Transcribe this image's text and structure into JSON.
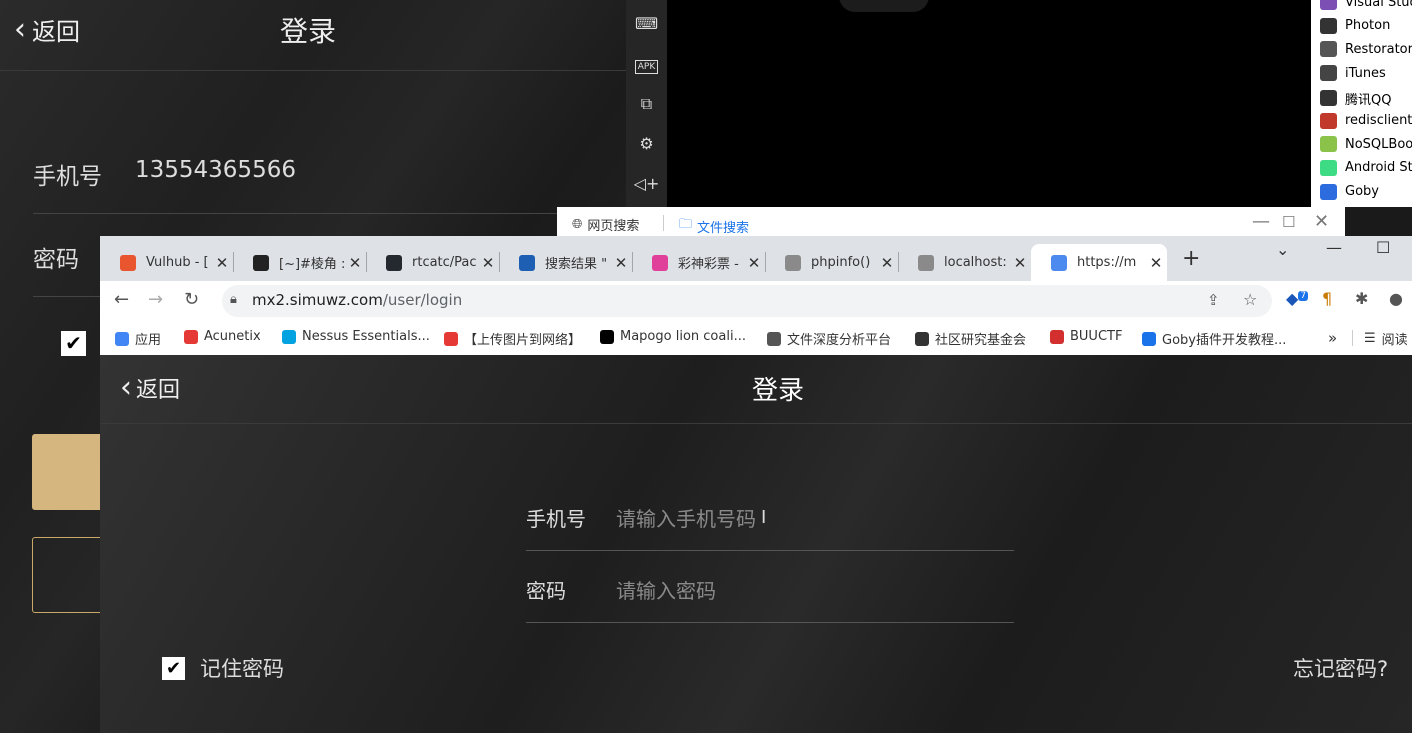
{
  "emulator": {
    "back_label": "返回",
    "title": "登录",
    "phone_label": "手机号",
    "phone_value": "13554365566",
    "password_label": "密码",
    "toolbar_icons": [
      "keyboard-icon",
      "apk-icon",
      "screenshot-icon",
      "settings-icon",
      "volume-up-icon"
    ],
    "apk_text": "APK"
  },
  "desktop_list": {
    "items": [
      {
        "label": "Visual Studi",
        "color": "#7b4fb3"
      },
      {
        "label": "Photon",
        "color": "#333333"
      },
      {
        "label": "Restorator",
        "color": "#555555"
      },
      {
        "label": "iTunes",
        "color": "#444444"
      },
      {
        "label": "腾讯QQ",
        "color": "#333333"
      },
      {
        "label": "redisclient",
        "color": "#c0392b"
      },
      {
        "label": "NoSQLBoo",
        "color": "#8bc34a"
      },
      {
        "label": "Android St",
        "color": "#3ddc84"
      },
      {
        "label": "Goby",
        "color": "#2d6cdf"
      }
    ]
  },
  "search_window": {
    "tab1": "网页搜索",
    "tab2": "文件搜索",
    "controls": [
      "—",
      "☐",
      "✕"
    ]
  },
  "browser": {
    "tabs": [
      {
        "title": "Vulhub - [",
        "color": "#e8552f",
        "active": false
      },
      {
        "title": "[~]#棱角 :",
        "color": "#222222",
        "active": false
      },
      {
        "title": "rtcatc/Pac",
        "color": "#24292f",
        "active": false
      },
      {
        "title": "搜索结果 \"",
        "color": "#1e5fb4",
        "active": false
      },
      {
        "title": "彩神彩票 -",
        "color": "#e0409a",
        "active": false
      },
      {
        "title": "phpinfo()",
        "color": "#8a8a8a",
        "active": false
      },
      {
        "title": "localhost:",
        "color": "#8a8a8a",
        "active": false
      },
      {
        "title": "https://m",
        "color": "#4d8af0",
        "active": true
      }
    ],
    "new_tab": "+",
    "tab_search_icon": "⌄",
    "window_controls": [
      "—",
      "☐"
    ],
    "url_host": "mx2.simuwz.com",
    "url_path": "/user/login",
    "extension_badge": "7",
    "bookmarks": [
      {
        "label": "应用",
        "color": "#4285f4"
      },
      {
        "label": "Acunetix",
        "color": "#e53935"
      },
      {
        "label": "Nessus Essentials...",
        "color": "#00a3e0"
      },
      {
        "label": "【上传图片到网络】",
        "color": "#e53935"
      },
      {
        "label": "Mapogo lion coali...",
        "color": "#000000"
      },
      {
        "label": "文件深度分析平台",
        "color": "#555555"
      },
      {
        "label": "社区研究基金会",
        "color": "#333333"
      },
      {
        "label": "BUUCTF",
        "color": "#d32f2f"
      },
      {
        "label": "Goby插件开发教程...",
        "color": "#1a73e8"
      }
    ],
    "bookmarks_more": "»",
    "reading_list": "阅读"
  },
  "login_page": {
    "back_label": "返回",
    "title": "登录",
    "phone_label": "手机号",
    "phone_placeholder": "请输入手机号码",
    "password_label": "密码",
    "password_placeholder": "请输入密码",
    "remember_label": "记住密码",
    "remember_checked": true,
    "forgot_label": "忘记密码?"
  }
}
